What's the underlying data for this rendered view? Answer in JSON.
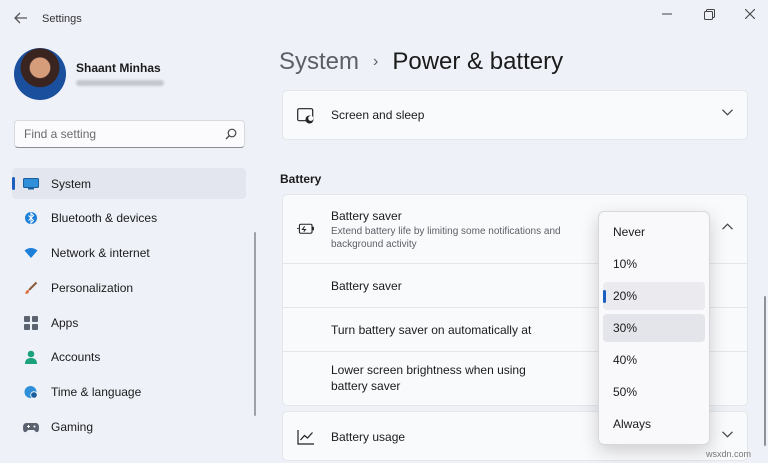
{
  "window": {
    "title": "Settings",
    "back_icon": "back-arrow-icon",
    "minimize_icon": "minimize-icon",
    "maximize_icon": "restore-icon",
    "close_icon": "close-icon"
  },
  "user": {
    "name": "Shaant Minhas"
  },
  "search": {
    "placeholder": "Find a setting",
    "icon": "search-icon"
  },
  "sidebar": {
    "items": [
      {
        "label": "System",
        "icon": "monitor-icon",
        "selected": true
      },
      {
        "label": "Bluetooth & devices",
        "icon": "bluetooth-icon"
      },
      {
        "label": "Network & internet",
        "icon": "wifi-icon"
      },
      {
        "label": "Personalization",
        "icon": "brush-icon"
      },
      {
        "label": "Apps",
        "icon": "apps-icon"
      },
      {
        "label": "Accounts",
        "icon": "person-icon"
      },
      {
        "label": "Time & language",
        "icon": "globe-clock-icon"
      },
      {
        "label": "Gaming",
        "icon": "controller-icon"
      }
    ]
  },
  "breadcrumb": {
    "root": "System",
    "separator": "›",
    "current": "Power & battery"
  },
  "cards": {
    "screen_sleep": {
      "label": "Screen and sleep",
      "icon": "screen-sleep-icon"
    },
    "battery_usage": {
      "label": "Battery usage",
      "icon": "chart-icon"
    }
  },
  "battery": {
    "section_title": "Battery",
    "saver": {
      "title": "Battery saver",
      "description": "Extend battery life by limiting some notifications and background activity",
      "icon": "battery-saver-icon"
    },
    "rows": [
      {
        "label": "Battery saver"
      },
      {
        "label": "Turn battery saver on automatically at"
      },
      {
        "label": "Lower screen brightness when using battery saver"
      }
    ]
  },
  "dropdown": {
    "options": [
      "Never",
      "10%",
      "20%",
      "30%",
      "40%",
      "50%",
      "Always"
    ],
    "selected": "20%",
    "hovered": "30%"
  },
  "colors": {
    "accent": "#1d5fbf",
    "background": "#eef1f8",
    "card": "#f9fafc"
  },
  "watermark": "wsxdn.com"
}
